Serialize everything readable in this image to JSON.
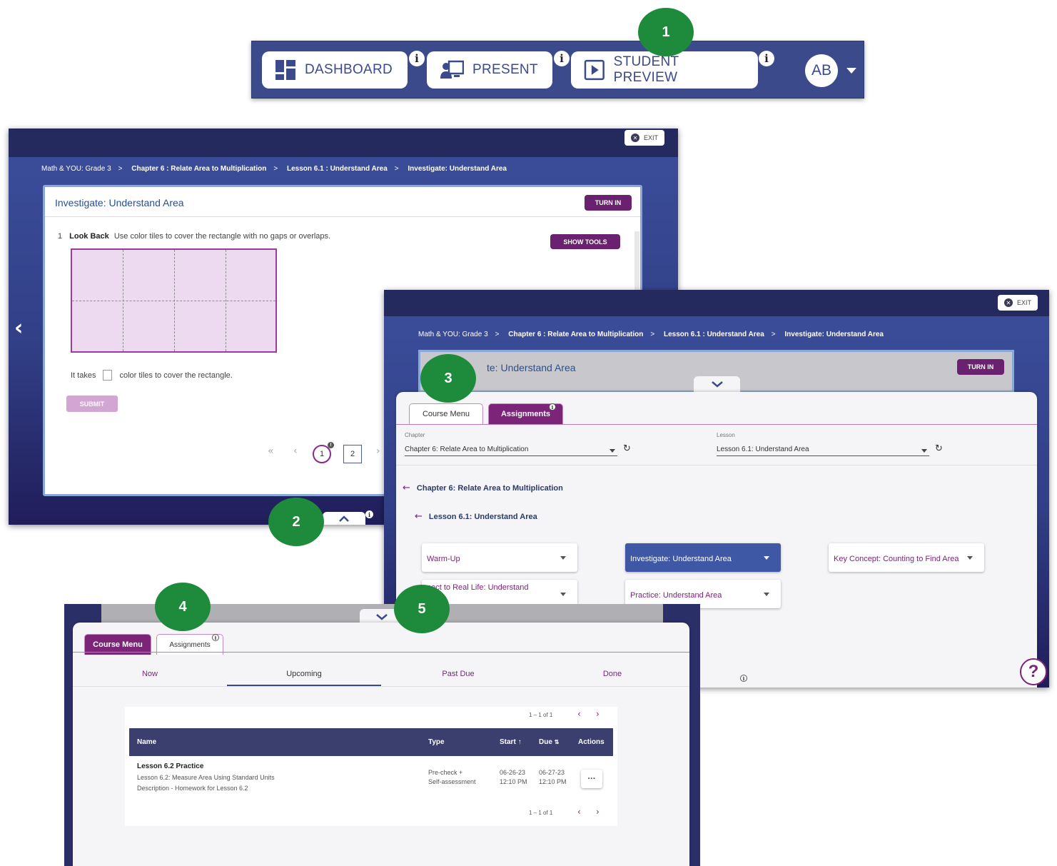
{
  "markers": [
    "1",
    "2",
    "3",
    "4",
    "5"
  ],
  "toolbar": {
    "dashboard": "DASHBOARD",
    "present": "PRESENT",
    "student_preview": "STUDENT PREVIEW",
    "avatar": "AB"
  },
  "panel1": {
    "exit": "EXIT",
    "crumbs": [
      "Math & YOU: Grade 3",
      "Chapter 6 : Relate Area to Multiplication",
      "Lesson 6.1 : Understand Area",
      "Investigate: Understand Area"
    ],
    "title": "Investigate: Understand Area",
    "turn_in": "TURN IN",
    "q_num": "1",
    "q_lead": "Look Back",
    "q_text": "Use color tiles to cover the rectangle with no gaps or overlaps.",
    "show_tools": "SHOW TOOLS",
    "it_takes": "It takes",
    "it_takes_rest": "color tiles to cover the rectangle.",
    "submit": "SUBMIT",
    "page_1": "1",
    "page_2": "2",
    "page_badge": "!"
  },
  "panel2": {
    "exit": "EXIT",
    "crumbs": [
      "Math & YOU: Grade 3",
      "Chapter 6 : Relate Area to Multiplication",
      "Lesson 6.1 : Understand Area",
      "Investigate: Understand Area"
    ],
    "title_partial": "te: Understand Area",
    "turn_in": "TURN IN",
    "tab_course_menu": "Course Menu",
    "tab_assignments": "Assignments",
    "chapter_label": "Chapter",
    "chapter_value": "Chapter 6: Relate Area to Multiplication",
    "lesson_label": "Lesson",
    "lesson_value": "Lesson 6.1: Understand Area",
    "back_chapter": "Chapter 6: Relate Area to Multiplication",
    "back_lesson": "Lesson 6.1: Understand Area",
    "cards": [
      "Warm-Up",
      "Investigate: Understand Area",
      "Key Concept: Counting to Find Area",
      "nect to Real Life: Understand",
      "Practice: Understand Area"
    ],
    "help": "?"
  },
  "panel3": {
    "tab_course_menu": "Course Menu",
    "tab_assignments": "Assignments",
    "subtabs": [
      "Now",
      "Upcoming",
      "Past Due",
      "Done"
    ],
    "pagination": "1 – 1 of 1",
    "headers": {
      "name": "Name",
      "type": "Type",
      "start": "Start",
      "due": "Due",
      "actions": "Actions"
    },
    "row": {
      "name": "Lesson 6.2 Practice",
      "line2": "Lesson 6.2: Measure Area Using Standard Units",
      "line3": "Description - Homework for Lesson 6.2",
      "type1": "Pre-check +",
      "type2": "Self-assessment",
      "start_date": "06-26-23",
      "start_time": "12:10 PM",
      "due_date": "06-27-23",
      "due_time": "12:10 PM",
      "action": "···"
    }
  }
}
